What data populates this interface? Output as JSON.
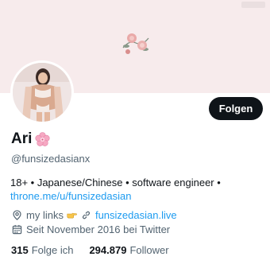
{
  "profile": {
    "display_name": "Ari",
    "handle": "@funsizedasianx",
    "bio_text": "18+ • Japanese/Chinese • software engineer •",
    "bio_link": "throne.me/u/funsizedasian",
    "location": "my links",
    "website": "funsizedasian.live",
    "joined": "Seit November 2016 bei Twitter"
  },
  "actions": {
    "follow_label": "Folgen"
  },
  "stats": {
    "following_count": "315",
    "following_label": "Folge ich",
    "followers_count": "294.879",
    "followers_label": "Follower"
  },
  "icons": {
    "location": "location-pin-icon",
    "link": "link-icon",
    "calendar": "calendar-icon",
    "name_emoji": "cherry-blossom-icon",
    "pointing_hand": "pointing-hand-icon"
  },
  "colors": {
    "accent": "#1d9bf0",
    "banner": "#f7ebec",
    "button": "#0f1419",
    "secondary_text": "#536471"
  }
}
